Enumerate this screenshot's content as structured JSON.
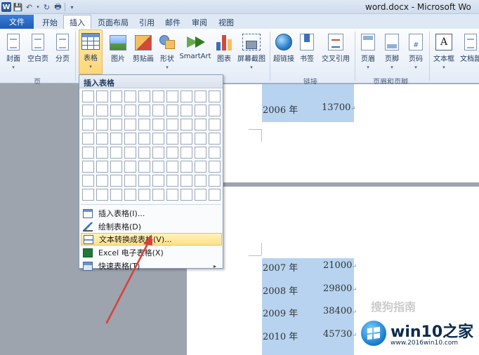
{
  "title_bar": {
    "title": "word.docx - Microsoft Wo"
  },
  "quick_access": [
    "W",
    "save-icon",
    "undo-icon",
    "redo-icon",
    "customize-icon"
  ],
  "tabs": [
    {
      "label": "文件",
      "active": false
    },
    {
      "label": "开始",
      "active": false
    },
    {
      "label": "插入",
      "active": true
    },
    {
      "label": "页面布局",
      "active": false
    },
    {
      "label": "引用",
      "active": false
    },
    {
      "label": "邮件",
      "active": false
    },
    {
      "label": "审阅",
      "active": false
    },
    {
      "label": "视图",
      "active": false
    }
  ],
  "ribbon": {
    "buttons": [
      {
        "label": "封面",
        "dropdown": "▾"
      },
      {
        "label": "空白页"
      },
      {
        "label": "分页"
      },
      {
        "label": "表格",
        "dropdown": "▾",
        "selected": true
      },
      {
        "label": "图片"
      },
      {
        "label": "剪贴画"
      },
      {
        "label": "形状",
        "dropdown": "▾"
      },
      {
        "label": "SmartArt"
      },
      {
        "label": "图表"
      },
      {
        "label": "屏幕截图",
        "dropdown": "▾"
      },
      {
        "label": "超链接"
      },
      {
        "label": "书签"
      },
      {
        "label": "交叉引用"
      },
      {
        "label": "页眉",
        "dropdown": "▾"
      },
      {
        "label": "页脚",
        "dropdown": "▾"
      },
      {
        "label": "页码",
        "dropdown": "▾"
      },
      {
        "label": "文本框",
        "dropdown": "▾"
      },
      {
        "label": "文档部"
      }
    ],
    "groups": {
      "pages": "页",
      "links": "链接",
      "header_footer": "页眉和页脚"
    }
  },
  "table_dropdown": {
    "heading": "插入表格",
    "grid_cols": 10,
    "grid_rows": 8,
    "items": [
      {
        "label": "插入表格(I)...",
        "icon": "insert-table-icon",
        "highlighted": false
      },
      {
        "label": "绘制表格(D)",
        "icon": "pencil-icon",
        "highlighted": false
      },
      {
        "label": "文本转换成表格(V)...",
        "icon": "convert-text-icon",
        "highlighted": true
      },
      {
        "label": "Excel 电子表格(X)",
        "icon": "excel-icon",
        "highlighted": false
      },
      {
        "label": "快速表格(T)",
        "icon": "quick-table-icon",
        "highlighted": false,
        "submenu": "▸"
      }
    ]
  },
  "document": {
    "page1_rows": [
      {
        "year": "2006 年",
        "value": "13700",
        "mark": "↵"
      }
    ],
    "page2_rows": [
      {
        "year": "2007 年",
        "value": "21000",
        "mark": "↵"
      },
      {
        "year": "2008 年",
        "value": "29800",
        "mark": "↵"
      },
      {
        "year": "2009 年",
        "value": "38400",
        "mark": "↵"
      },
      {
        "year": "2010 年",
        "value": "45730",
        "mark": "↵"
      }
    ]
  },
  "watermark": {
    "sogou": "搜狗指南",
    "brand": "win10之家",
    "url": "www.2016win10.com"
  },
  "colors": {
    "selection": "#b7d3ef",
    "file_tab": "#1f5bb3",
    "arrow": "#d9403a",
    "menu_highlight": "#ffe28a"
  }
}
